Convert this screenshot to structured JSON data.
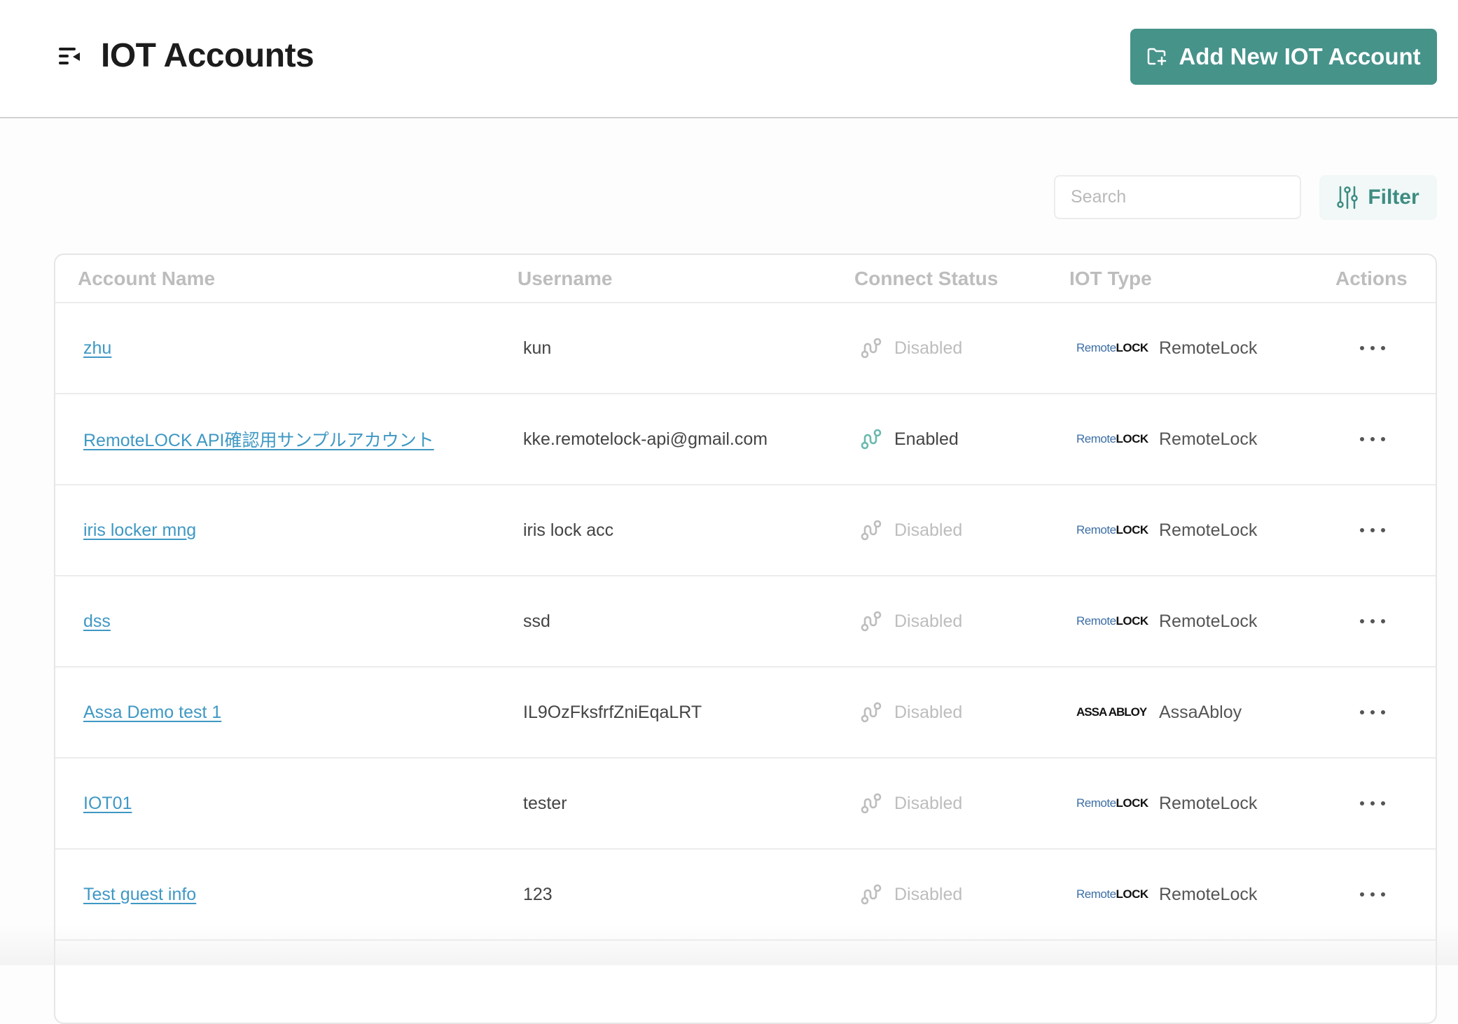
{
  "header": {
    "title": "IOT Accounts",
    "menu_icon": "collapse-menu-icon",
    "add_button_label": "Add New IOT Account",
    "add_button_icon": "folder-add-icon"
  },
  "toolbar": {
    "search_placeholder": "Search",
    "search_value": "",
    "filter_label": "Filter"
  },
  "colors": {
    "accent": "#46938a",
    "link": "#3f98c4",
    "enabled_icon": "#6ab9ae",
    "disabled": "#bdbdbd"
  },
  "table": {
    "columns": [
      "Account Name",
      "Username",
      "Connect Status",
      "IOT Type",
      "Actions"
    ],
    "rows": [
      {
        "account_name": "zhu",
        "username": "kun",
        "status": "Disabled",
        "enabled": false,
        "iot_type": "RemoteLock",
        "logo": "remotelock"
      },
      {
        "account_name": "RemoteLOCK API確認用サンプルアカウント",
        "username": "kke.remotelock-api@gmail.com",
        "status": "Enabled",
        "enabled": true,
        "iot_type": "RemoteLock",
        "logo": "remotelock"
      },
      {
        "account_name": "iris locker mng",
        "username": "iris lock acc",
        "status": "Disabled",
        "enabled": false,
        "iot_type": "RemoteLock",
        "logo": "remotelock"
      },
      {
        "account_name": "dss",
        "username": "ssd",
        "status": "Disabled",
        "enabled": false,
        "iot_type": "RemoteLock",
        "logo": "remotelock"
      },
      {
        "account_name": "Assa Demo test 1",
        "username": "IL9OzFksfrfZniEqaLRT",
        "status": "Disabled",
        "enabled": false,
        "iot_type": "AssaAbloy",
        "logo": "assaabloy"
      },
      {
        "account_name": "IOT01",
        "username": "tester",
        "status": "Disabled",
        "enabled": false,
        "iot_type": "RemoteLock",
        "logo": "remotelock"
      },
      {
        "account_name": "Test guest info",
        "username": "123",
        "status": "Disabled",
        "enabled": false,
        "iot_type": "RemoteLock",
        "logo": "remotelock"
      }
    ]
  },
  "logos": {
    "remotelock_a": "Remote",
    "remotelock_b": "LOCK",
    "assaabloy": "ASSA ABLOY"
  }
}
